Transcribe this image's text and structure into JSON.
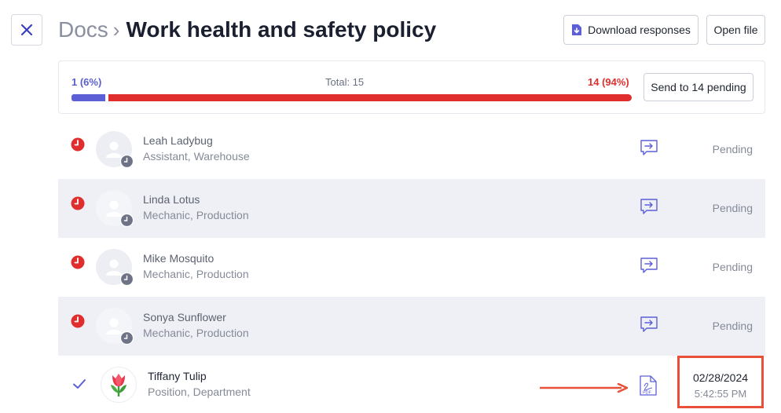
{
  "header": {
    "breadcrumb_root": "Docs",
    "breadcrumb_sep": "›",
    "title": "Work health and safety policy"
  },
  "toolbar": {
    "download_label": "Download responses",
    "open_label": "Open file"
  },
  "summary": {
    "completed": "1 (6%)",
    "total": "Total: 15",
    "pending": "14 (94%)",
    "completed_fraction": 0.06,
    "send_label": "Send to 14 pending"
  },
  "employees": [
    {
      "name": "Leah Ladybug",
      "role": "Assistant, Warehouse",
      "status": "Pending"
    },
    {
      "name": "Linda Lotus",
      "role": "Mechanic, Production",
      "status": "Pending"
    },
    {
      "name": "Mike Mosquito",
      "role": "Mechanic, Production",
      "status": "Pending"
    },
    {
      "name": "Sonya Sunflower",
      "role": "Mechanic, Production",
      "status": "Pending"
    },
    {
      "name": "Tiffany Tulip",
      "role": "Position, Department",
      "date": "02/28/2024",
      "time": "5:42:55 PM"
    }
  ],
  "colors": {
    "accent": "#5c5fd6",
    "pending": "#e02e2e",
    "highlight": "#e8503a"
  }
}
